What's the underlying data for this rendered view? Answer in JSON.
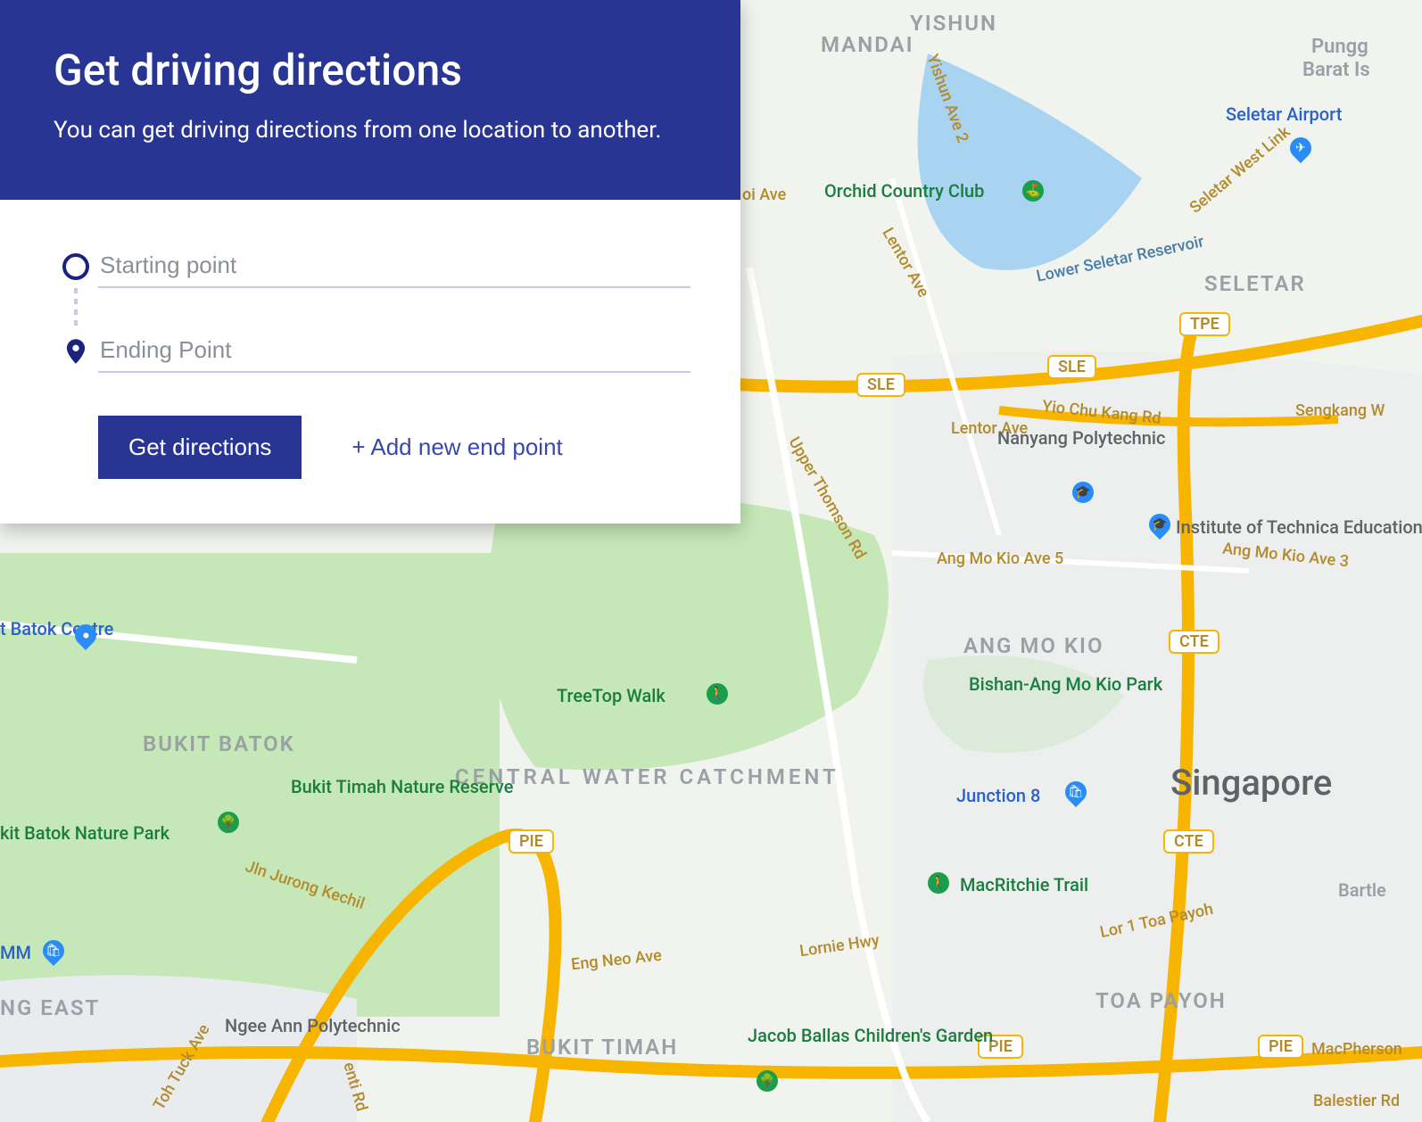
{
  "panel": {
    "title": "Get driving directions",
    "subtitle": "You can get driving directions from one location to another.",
    "start_placeholder": "Starting point",
    "start_value": "",
    "end_placeholder": "Ending Point",
    "end_value": "",
    "get_button": "Get directions",
    "add_button": "+ Add new end point"
  },
  "map": {
    "city": "Singapore",
    "areas": [
      "MANDAI",
      "YISHUN",
      "SELETAR",
      "BUKIT BATOK",
      "ANG MO KIO",
      "TOA PAYOH",
      "BUKIT TIMAH",
      "CENTRAL WATER CATCHMENT",
      "NG EAST"
    ],
    "area_frag_punggol": "Pungg",
    "area_frag_barat": "Barat Is",
    "area_frag_bartle": "Bartle",
    "roads": {
      "sle1": "SLE",
      "sle2": "SLE",
      "tpe": "TPE",
      "pie1": "PIE",
      "pie2": "PIE",
      "pie3": "PIE",
      "cte1": "CTE",
      "cte2": "CTE",
      "yio_chu_kang": "Yio Chu Kang Rd",
      "ang_mo_kio_5": "Ang Mo Kio Ave 5",
      "ang_mo_kio_3": "Ang Mo Kio Ave 3",
      "upper_thomson": "Upper Thomson Rd",
      "lentor": "Lentor Ave",
      "yishun_ave2": "Yishun Ave 2",
      "jln_jurong": "Jln Jurong Kechil",
      "toh_tuck": "Toh Tuck Ave",
      "lornie": "Lornie Hwy",
      "eng_neo": "Eng Neo Ave",
      "balestier": "Balestier Rd",
      "mac_pherson": "MacPherson",
      "lor1_toa_payoh": "Lor 1 Toa Payoh",
      "sengkang": "Sengkang W",
      "west_link": "Seletar West Link",
      "enti_rd": "enti Rd",
      "oi_ave": "oi Ave"
    },
    "water": {
      "lower_seletar": "Lower Seletar Reservoir"
    },
    "green": {
      "orchid": "Orchid Country Club",
      "bukit_timah_reserve": "Bukit Timah Nature Reserve",
      "bishan_park": "Bishan-Ang Mo Kio Park",
      "treetop": "TreeTop Walk",
      "macritchie": "MacRitchie Trail",
      "jacob_ballas": "Jacob Ballas Children's Garden",
      "batok_park": "kit Batok Nature Park"
    },
    "poi": {
      "seletar_airport": "Seletar Airport",
      "nanyang_poly": "Nanyang Polytechnic",
      "ite": "Institute of Technica Education (ITE)",
      "junction8": "Junction 8",
      "ngee_ann": "Ngee Ann Polytechnic",
      "batok_centre": "t Batok Centre",
      "imm": "MM"
    }
  }
}
